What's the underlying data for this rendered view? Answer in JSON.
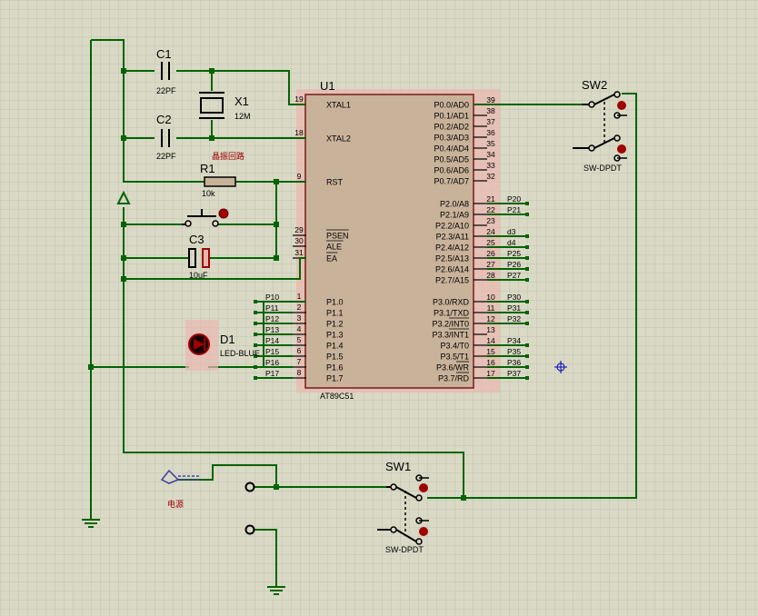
{
  "colors": {
    "background": "#d9d9c6",
    "grid": "#c2c2ae",
    "wire": "#006400",
    "chip_fill": "#c9b29a",
    "chip_glow": "#e8b8b0",
    "red": "#a00000",
    "cn_label": "#a00000"
  },
  "chip": {
    "ref": "U1",
    "part": "AT89C51"
  },
  "components": {
    "c1": {
      "ref": "C1",
      "value": "22PF"
    },
    "c2": {
      "ref": "C2",
      "value": "22PF"
    },
    "x1": {
      "ref": "X1",
      "value": "12M"
    },
    "r1": {
      "ref": "R1",
      "value": "10k"
    },
    "c3": {
      "ref": "C3",
      "value": "10uF"
    },
    "d1": {
      "ref": "D1",
      "value": "LED-BLUE"
    },
    "sw1": {
      "ref": "SW1",
      "value": "SW-DPDT"
    },
    "sw2": {
      "ref": "SW2",
      "value": "SW-DPDT"
    }
  },
  "notes": {
    "osc_circuit": "晶振回路",
    "power": "电源"
  },
  "left_pins": [
    {
      "num": "19",
      "name": "XTAL1"
    },
    {
      "num": "18",
      "name": "XTAL2"
    },
    {
      "num": "9",
      "name": "RST"
    },
    {
      "num": "29",
      "name": "PSEN"
    },
    {
      "num": "30",
      "name": "ALE"
    },
    {
      "num": "31",
      "name": "EA"
    },
    {
      "num": "1",
      "name": "P1.0",
      "net": "P10"
    },
    {
      "num": "2",
      "name": "P1.1",
      "net": "P11"
    },
    {
      "num": "3",
      "name": "P1.2",
      "net": "P12"
    },
    {
      "num": "4",
      "name": "P1.3",
      "net": "P13"
    },
    {
      "num": "5",
      "name": "P1.4",
      "net": "P14"
    },
    {
      "num": "6",
      "name": "P1.5",
      "net": "P15"
    },
    {
      "num": "7",
      "name": "P1.6",
      "net": "P16"
    },
    {
      "num": "8",
      "name": "P1.7",
      "net": "P17"
    }
  ],
  "right_pins": [
    {
      "num": "39",
      "name": "P0.0/AD0"
    },
    {
      "num": "38",
      "name": "P0.1/AD1"
    },
    {
      "num": "37",
      "name": "P0.2/AD2"
    },
    {
      "num": "36",
      "name": "P0.3/AD3"
    },
    {
      "num": "35",
      "name": "P0.4/AD4"
    },
    {
      "num": "34",
      "name": "P0.5/AD5"
    },
    {
      "num": "33",
      "name": "P0.6/AD6"
    },
    {
      "num": "32",
      "name": "P0.7/AD7"
    },
    {
      "num": "21",
      "name": "P2.0/A8",
      "net": "P20"
    },
    {
      "num": "22",
      "name": "P2.1/A9",
      "net": "P21"
    },
    {
      "num": "23",
      "name": "P2.2/A10",
      "net": ""
    },
    {
      "num": "24",
      "name": "P2.3/A11",
      "net": "d3"
    },
    {
      "num": "25",
      "name": "P2.4/A12",
      "net": "d4"
    },
    {
      "num": "26",
      "name": "P2.5/A13",
      "net": "P25"
    },
    {
      "num": "27",
      "name": "P2.6/A14",
      "net": "P26"
    },
    {
      "num": "28",
      "name": "P2.7/A15",
      "net": "P27"
    },
    {
      "num": "10",
      "name": "P3.0/RXD",
      "net": "P30"
    },
    {
      "num": "11",
      "name": "P3.1/TXD",
      "net": "P31"
    },
    {
      "num": "12",
      "name": "P3.2/INT0",
      "net": "P32"
    },
    {
      "num": "13",
      "name": "P3.3/INT1",
      "net": ""
    },
    {
      "num": "14",
      "name": "P3.4/T0",
      "net": "P34"
    },
    {
      "num": "15",
      "name": "P3.5/T1",
      "net": "P35"
    },
    {
      "num": "16",
      "name": "P3.6/WR",
      "net": "P36"
    },
    {
      "num": "17",
      "name": "P3.7/RD",
      "net": "P37"
    }
  ]
}
